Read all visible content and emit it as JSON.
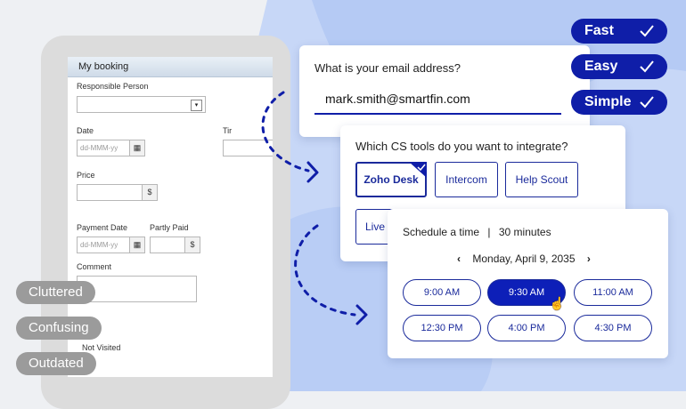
{
  "old_form": {
    "title": "My booking",
    "responsible_person_label": "Responsible Person",
    "date_label": "Date",
    "time_label_partial": "Tir",
    "date_placeholder": "dd-MMM-yy",
    "price_label": "Price",
    "currency_symbol": "$",
    "payment_date_label": "Payment Date",
    "partly_paid_label": "Partly Paid",
    "payment_date_placeholder": "dd-MMM-yy",
    "comment_label": "Comment",
    "status_value": "Not Visited"
  },
  "bad_tags": [
    "Cluttered",
    "Confusing",
    "Outdated"
  ],
  "good_tags": [
    "Fast",
    "Easy",
    "Simple"
  ],
  "email_card": {
    "question": "What is your email address?",
    "value": "mark.smith@smartfin.com"
  },
  "tools_card": {
    "question": "Which  CS tools do you want to integrate?",
    "options": [
      "Zoho Desk",
      "Intercom",
      "Help Scout",
      "Live"
    ],
    "selected": "Zoho Desk"
  },
  "schedule_card": {
    "title": "Schedule a time",
    "separator": "|",
    "duration": "30 minutes",
    "date": "Monday, April 9, 2035",
    "slots": [
      "9:00 AM",
      "9:30 AM",
      "11:00 AM",
      "12:30 PM",
      "4:00 PM",
      "4:30 PM"
    ],
    "selected_slot": "9:30 AM"
  },
  "colors": {
    "accent": "#0f1ea8",
    "selected_slot": "#0d1fb8",
    "blue_panel": "#c7d7f7",
    "blue_panel_light": "#b5caf4",
    "grey_tag": "#9b9b9b"
  }
}
